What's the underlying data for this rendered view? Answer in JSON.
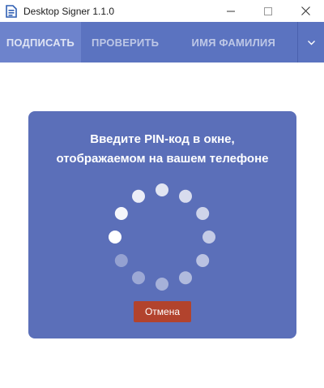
{
  "window": {
    "title": "Desktop Signer 1.1.0",
    "icon": "document-signer-icon",
    "controls": [
      "minimize-icon",
      "maximize-icon",
      "close-icon"
    ]
  },
  "nav": {
    "tabs": [
      {
        "label": "ПОДПИСАТЬ",
        "active": true
      },
      {
        "label": "ПРОВЕРИТЬ",
        "active": false
      },
      {
        "label": "ИМЯ ФАМИЛИЯ",
        "active": false
      }
    ],
    "dropdown_icon": "chevron-down-icon"
  },
  "dialog": {
    "message_line1": "Введите PIN-код в окне,",
    "message_line2": "отображаемом на вашем телефоне",
    "cancel_label": "Отмена",
    "spinner_icon": "loading-spinner-icon"
  },
  "colors": {
    "nav_bg": "#5b73c0",
    "nav_active_bg": "#6d83cc",
    "card_bg": "#5b6fb9",
    "cancel_bg": "#b2432d",
    "icon_blue": "#2f5fb3"
  }
}
